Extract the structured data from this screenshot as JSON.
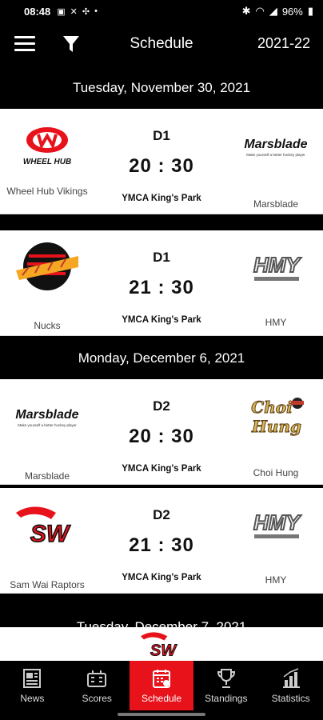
{
  "status_bar": {
    "time": "08:48",
    "battery": "96%"
  },
  "app_bar": {
    "title": "Schedule",
    "season": "2021-22"
  },
  "days": [
    {
      "date": "Tuesday, November 30, 2021",
      "games": [
        {
          "division": "D1",
          "time": "20 : 30",
          "venue": "YMCA King's Park",
          "home": "Wheel Hub Vikings",
          "away": "Marsblade"
        },
        {
          "division": "D1",
          "time": "21 : 30",
          "venue": "YMCA King's Park",
          "home": "Nucks",
          "away": "HMY"
        }
      ]
    },
    {
      "date": "Monday, December 6, 2021",
      "games": [
        {
          "division": "D2",
          "time": "20 : 30",
          "venue": "YMCA King's Park",
          "home": "Marsblade",
          "away": "Choi Hung"
        },
        {
          "division": "D2",
          "time": "21 : 30",
          "venue": "YMCA King's Park",
          "home": "Sam Wai Raptors",
          "away": "HMY"
        }
      ]
    }
  ],
  "logos": {
    "wheelhub": "WHEEL HUB",
    "marsblade": "Marsblade",
    "marsblade_tag": "Make yourself a better hockey player",
    "hmy": "HMY",
    "choihung_1": "Choi",
    "choihung_2": "Hung",
    "samwai": "SW"
  },
  "partial_header": "Tuesday, December 7, 2021",
  "bottom_nav": [
    {
      "label": "News",
      "icon": "news-icon",
      "active": false
    },
    {
      "label": "Scores",
      "icon": "scores-icon",
      "active": false
    },
    {
      "label": "Schedule",
      "icon": "schedule-icon",
      "active": true
    },
    {
      "label": "Standings",
      "icon": "trophy-icon",
      "active": false
    },
    {
      "label": "Statistics",
      "icon": "statistics-icon",
      "active": false
    }
  ],
  "colors": {
    "accent": "#e8121b",
    "bar": "#000000",
    "card": "#ffffff"
  }
}
